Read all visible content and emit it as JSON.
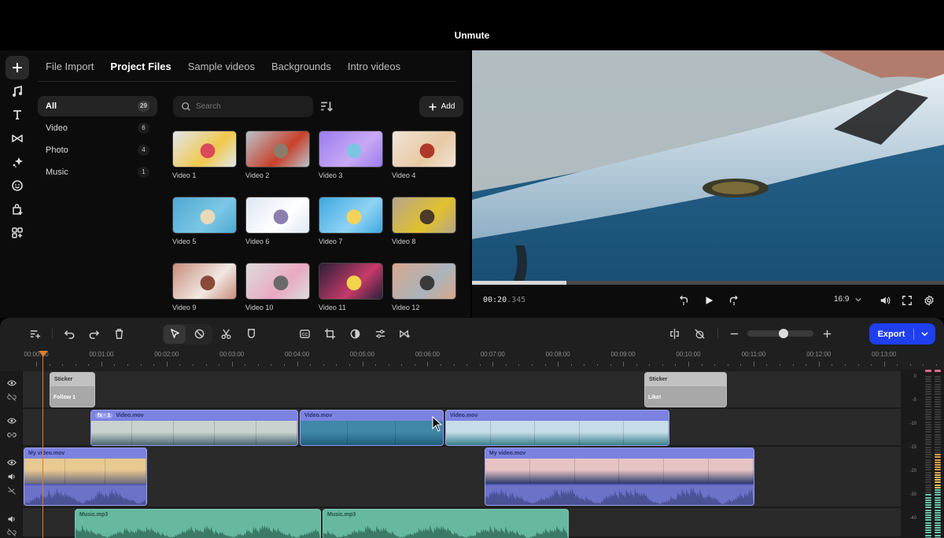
{
  "overlay": {
    "unmute_label": "Unmute"
  },
  "rail": {
    "items": [
      {
        "name": "add-media",
        "icon": "plus-icon",
        "active": true
      },
      {
        "name": "audio",
        "icon": "music-note-icon"
      },
      {
        "name": "text",
        "icon": "text-icon"
      },
      {
        "name": "transitions",
        "icon": "bowtie-icon"
      },
      {
        "name": "effects",
        "icon": "sparkle-icon"
      },
      {
        "name": "stickers",
        "icon": "smiley-icon"
      },
      {
        "name": "store",
        "icon": "bag-plus-icon"
      },
      {
        "name": "apps",
        "icon": "grid-plus-icon"
      }
    ]
  },
  "media": {
    "tabs": [
      {
        "label": "File Import",
        "active": false
      },
      {
        "label": "Project Files",
        "active": true
      },
      {
        "label": "Sample videos",
        "active": false
      },
      {
        "label": "Backgrounds",
        "active": false
      },
      {
        "label": "Intro videos",
        "active": false
      }
    ],
    "categories": [
      {
        "label": "All",
        "count": "29",
        "active": true
      },
      {
        "label": "Video",
        "count": "6"
      },
      {
        "label": "Photo",
        "count": "4"
      },
      {
        "label": "Music",
        "count": "1"
      }
    ],
    "search": {
      "placeholder": "Search",
      "value": ""
    },
    "add_label": "Add",
    "items": [
      {
        "label": "Video 1",
        "colors": [
          "#dfe6ee",
          "#f2c94c",
          "#d94a5b"
        ]
      },
      {
        "label": "Video 2",
        "colors": [
          "#b7c4cc",
          "#c8402a",
          "#8c7c6a"
        ]
      },
      {
        "label": "Video 3",
        "colors": [
          "#9a7cf0",
          "#c9a9f5",
          "#7cc4e4"
        ]
      },
      {
        "label": "Video 4",
        "colors": [
          "#f0e4d6",
          "#e8c9a4",
          "#b0382a"
        ]
      },
      {
        "label": "Video 5",
        "colors": [
          "#4fa8d0",
          "#7cc7e6",
          "#e9d9b8"
        ]
      },
      {
        "label": "Video 6",
        "colors": [
          "#dfe7f2",
          "#ffffff",
          "#8a7fb0"
        ]
      },
      {
        "label": "Video 7",
        "colors": [
          "#3fa7e0",
          "#8fd3f5",
          "#f5d25a"
        ]
      },
      {
        "label": "Video 8",
        "colors": [
          "#b6a58c",
          "#e0c12c",
          "#4a3a2a"
        ]
      },
      {
        "label": "Video 9",
        "colors": [
          "#c88c7c",
          "#f1e8e2",
          "#8a4a3a"
        ]
      },
      {
        "label": "Video 10",
        "colors": [
          "#dcdcdc",
          "#e9a9c2",
          "#6a6a6a"
        ]
      },
      {
        "label": "Video 11",
        "colors": [
          "#2a1f3a",
          "#c73a6a",
          "#f2d54a"
        ]
      },
      {
        "label": "Video 12",
        "colors": [
          "#d9a78a",
          "#aab4bc",
          "#3a3a3a"
        ]
      }
    ]
  },
  "player": {
    "timecode_main": "00:20",
    "timecode_ms": ".345",
    "progress_fraction": 0.2,
    "aspect_ratio": "16:9"
  },
  "timeline": {
    "export_label": "Export",
    "zoom_level_fraction": 0.55,
    "ruler": [
      "00:00:00",
      "00:01:00",
      "00:02:00",
      "00:03:00",
      "00:04:00",
      "00:05:00",
      "00:06:00",
      "00:07:00",
      "00:08:00",
      "00:09:00",
      "00:10:00",
      "00:11:00",
      "00:12:00",
      "00:13:00"
    ],
    "tracks": {
      "sticker": [
        {
          "title": "Sticker",
          "sub": "Follow 1"
        },
        {
          "title": "Sticker",
          "sub": "Like!"
        }
      ],
      "video": [
        {
          "title": "Video.mov",
          "fx": "fx · 1"
        },
        {
          "title": "Video.mov"
        },
        {
          "title": "Video.mov"
        }
      ],
      "main": [
        {
          "title": "My video.mov"
        },
        {
          "title": "My video.mov"
        }
      ],
      "music": [
        {
          "title": "Music.mp3"
        },
        {
          "title": "Music.mp3"
        }
      ]
    },
    "meter": {
      "labels": [
        "0",
        "-5",
        "-10",
        "-15",
        "-20",
        "-30",
        "-40"
      ],
      "left_level_db": -29,
      "right_level_db": -16
    }
  },
  "colors": {
    "accent": "#1f3ff0",
    "playhead": "#e07b30",
    "video_clip": "#7b82e0",
    "music_clip": "#66b8a0",
    "sticker_clip": "#a8a8a8"
  }
}
